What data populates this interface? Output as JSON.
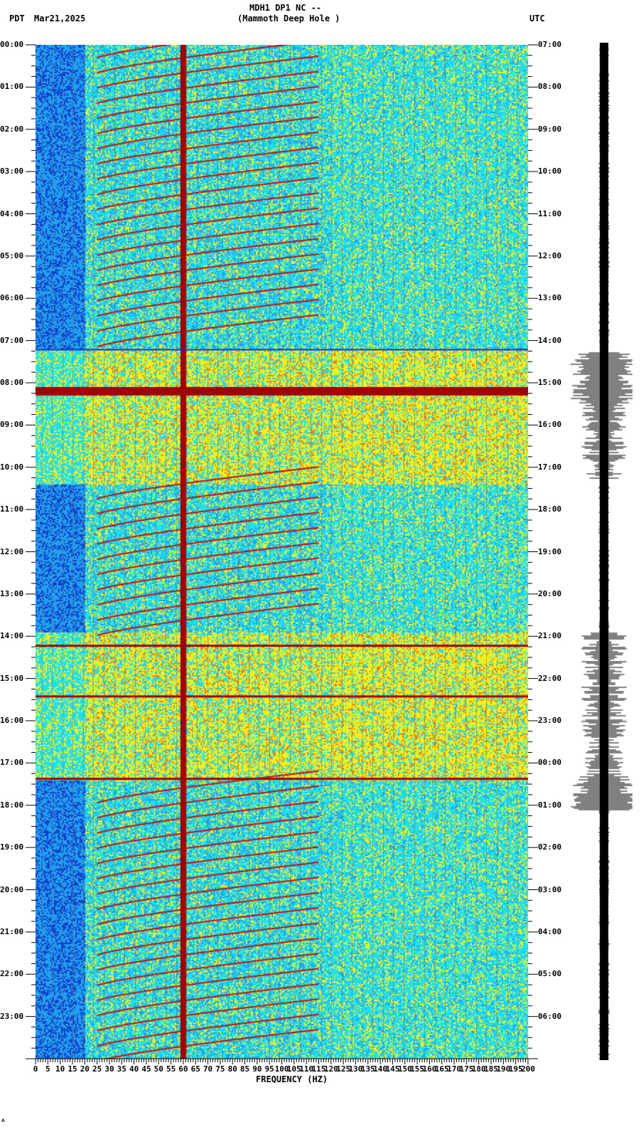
{
  "header": {
    "title_line1": "MDH1 DP1 NC --",
    "title_line2": "(Mammoth Deep Hole )",
    "left_tz": "PDT",
    "date": "Mar21,2025",
    "right_tz": "UTC"
  },
  "footer_mark": "ʌ",
  "chart_data": {
    "type": "heatmap",
    "title": "MDH1 DP1 NC -- (Mammoth Deep Hole )",
    "xlabel": "FREQUENCY (HZ)",
    "ylabel_left": "PDT",
    "ylabel_right": "UTC",
    "xlim": [
      0,
      200
    ],
    "ylim_hours": [
      0,
      24
    ],
    "x_ticks": [
      "0",
      "5",
      "10",
      "15",
      "20",
      "25",
      "30",
      "35",
      "40",
      "45",
      "50",
      "55",
      "60",
      "65",
      "70",
      "75",
      "80",
      "85",
      "90",
      "95",
      "100",
      "105",
      "110",
      "115",
      "120",
      "125",
      "130",
      "135",
      "140",
      "145",
      "150",
      "155",
      "160",
      "165",
      "170",
      "175",
      "180",
      "185",
      "190",
      "195",
      "200"
    ],
    "y_ticks_left": [
      "00:00",
      "01:00",
      "02:00",
      "03:00",
      "04:00",
      "05:00",
      "06:00",
      "07:00",
      "08:00",
      "09:00",
      "10:00",
      "11:00",
      "12:00",
      "13:00",
      "14:00",
      "15:00",
      "16:00",
      "17:00",
      "18:00",
      "19:00",
      "20:00",
      "21:00",
      "22:00",
      "23:00"
    ],
    "y_ticks_right": [
      "07:00",
      "08:00",
      "09:00",
      "10:00",
      "11:00",
      "12:00",
      "13:00",
      "14:00",
      "15:00",
      "16:00",
      "17:00",
      "18:00",
      "19:00",
      "20:00",
      "21:00",
      "22:00",
      "23:00",
      "00:00",
      "01:00",
      "02:00",
      "03:00",
      "04:00",
      "05:00",
      "06:00"
    ],
    "persistent_line_hz": 60,
    "noisy_periods_pdt_hours": [
      [
        7.2,
        10.4
      ],
      [
        13.9,
        17.4
      ]
    ],
    "colormap": [
      "#1040d0",
      "#20a0f0",
      "#20e0f0",
      "#f0f020",
      "#f08010",
      "#a00000"
    ]
  }
}
